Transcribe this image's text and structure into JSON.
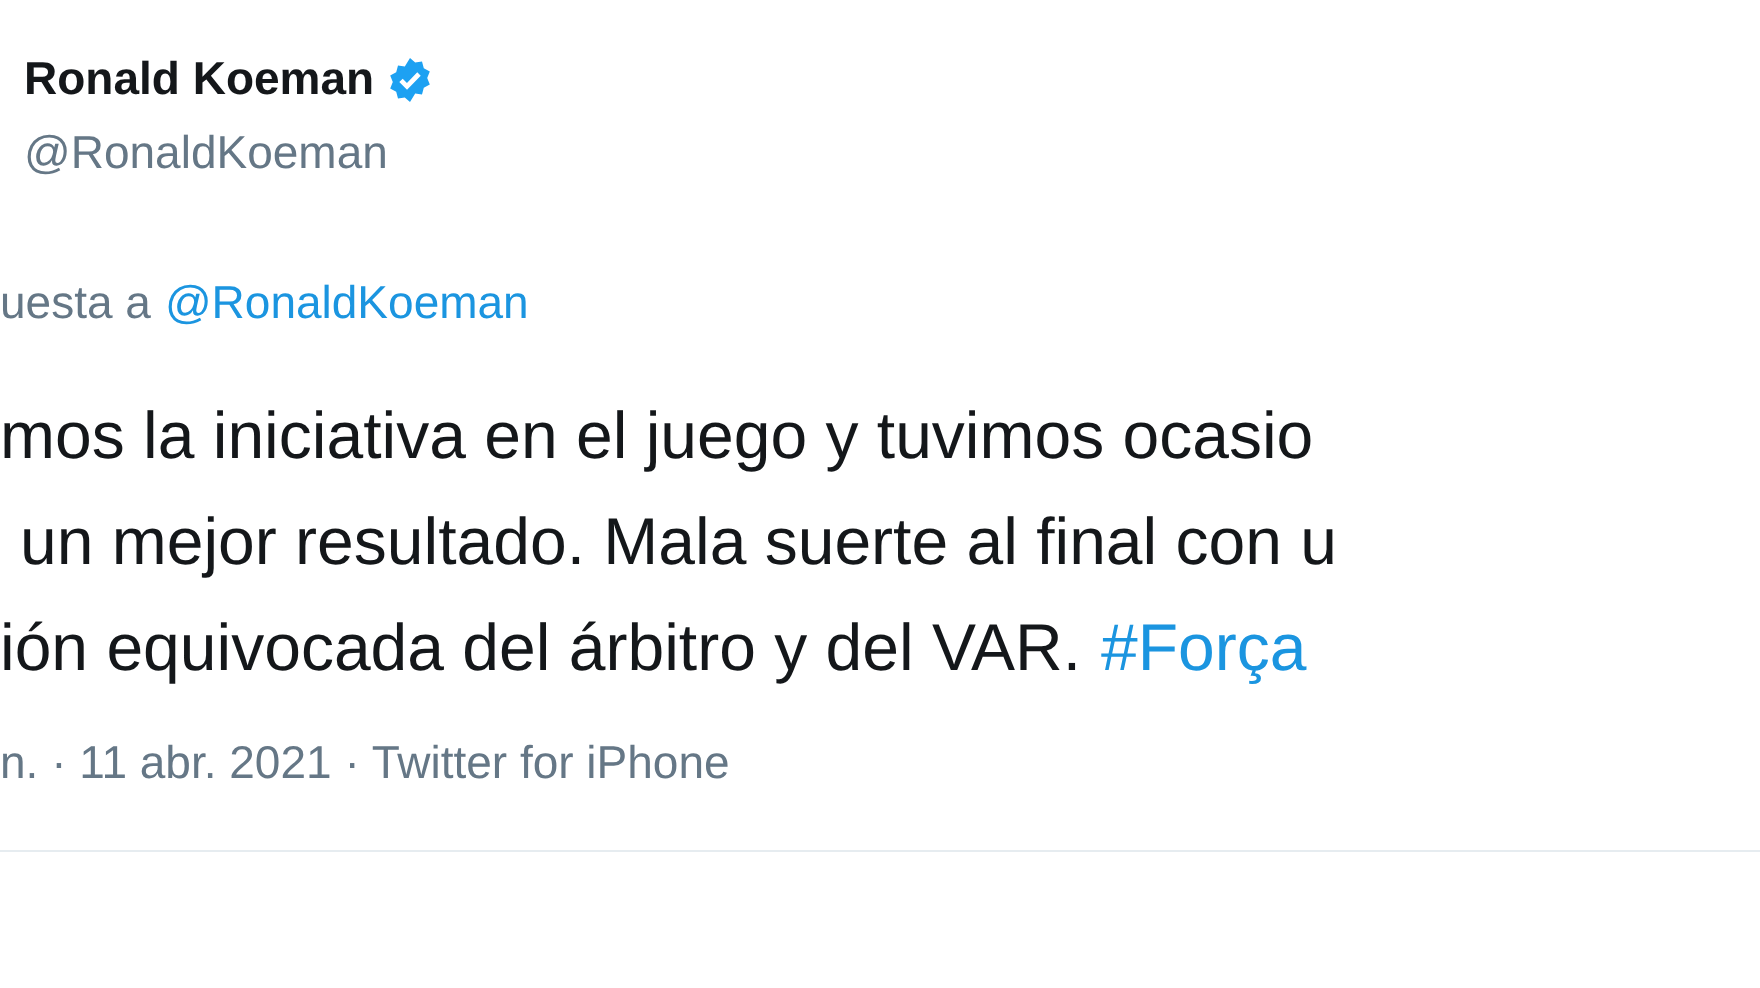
{
  "author": {
    "name": "Ronald Koeman",
    "verified": true,
    "handle": "@RonaldKoeman"
  },
  "reply_to": {
    "label": "uesta a",
    "link": "@RonaldKoeman"
  },
  "tweet": {
    "lines": [
      "mos la iniciativa en el juego y tuvimos ocasio",
      "un mejor resultado. Mala suerte al final con u",
      "ión equivocada del árbitro y del VAR."
    ],
    "hashtag": "#Força"
  },
  "meta": "n. · 11 abr. 2021 · Twitter for iPhone"
}
